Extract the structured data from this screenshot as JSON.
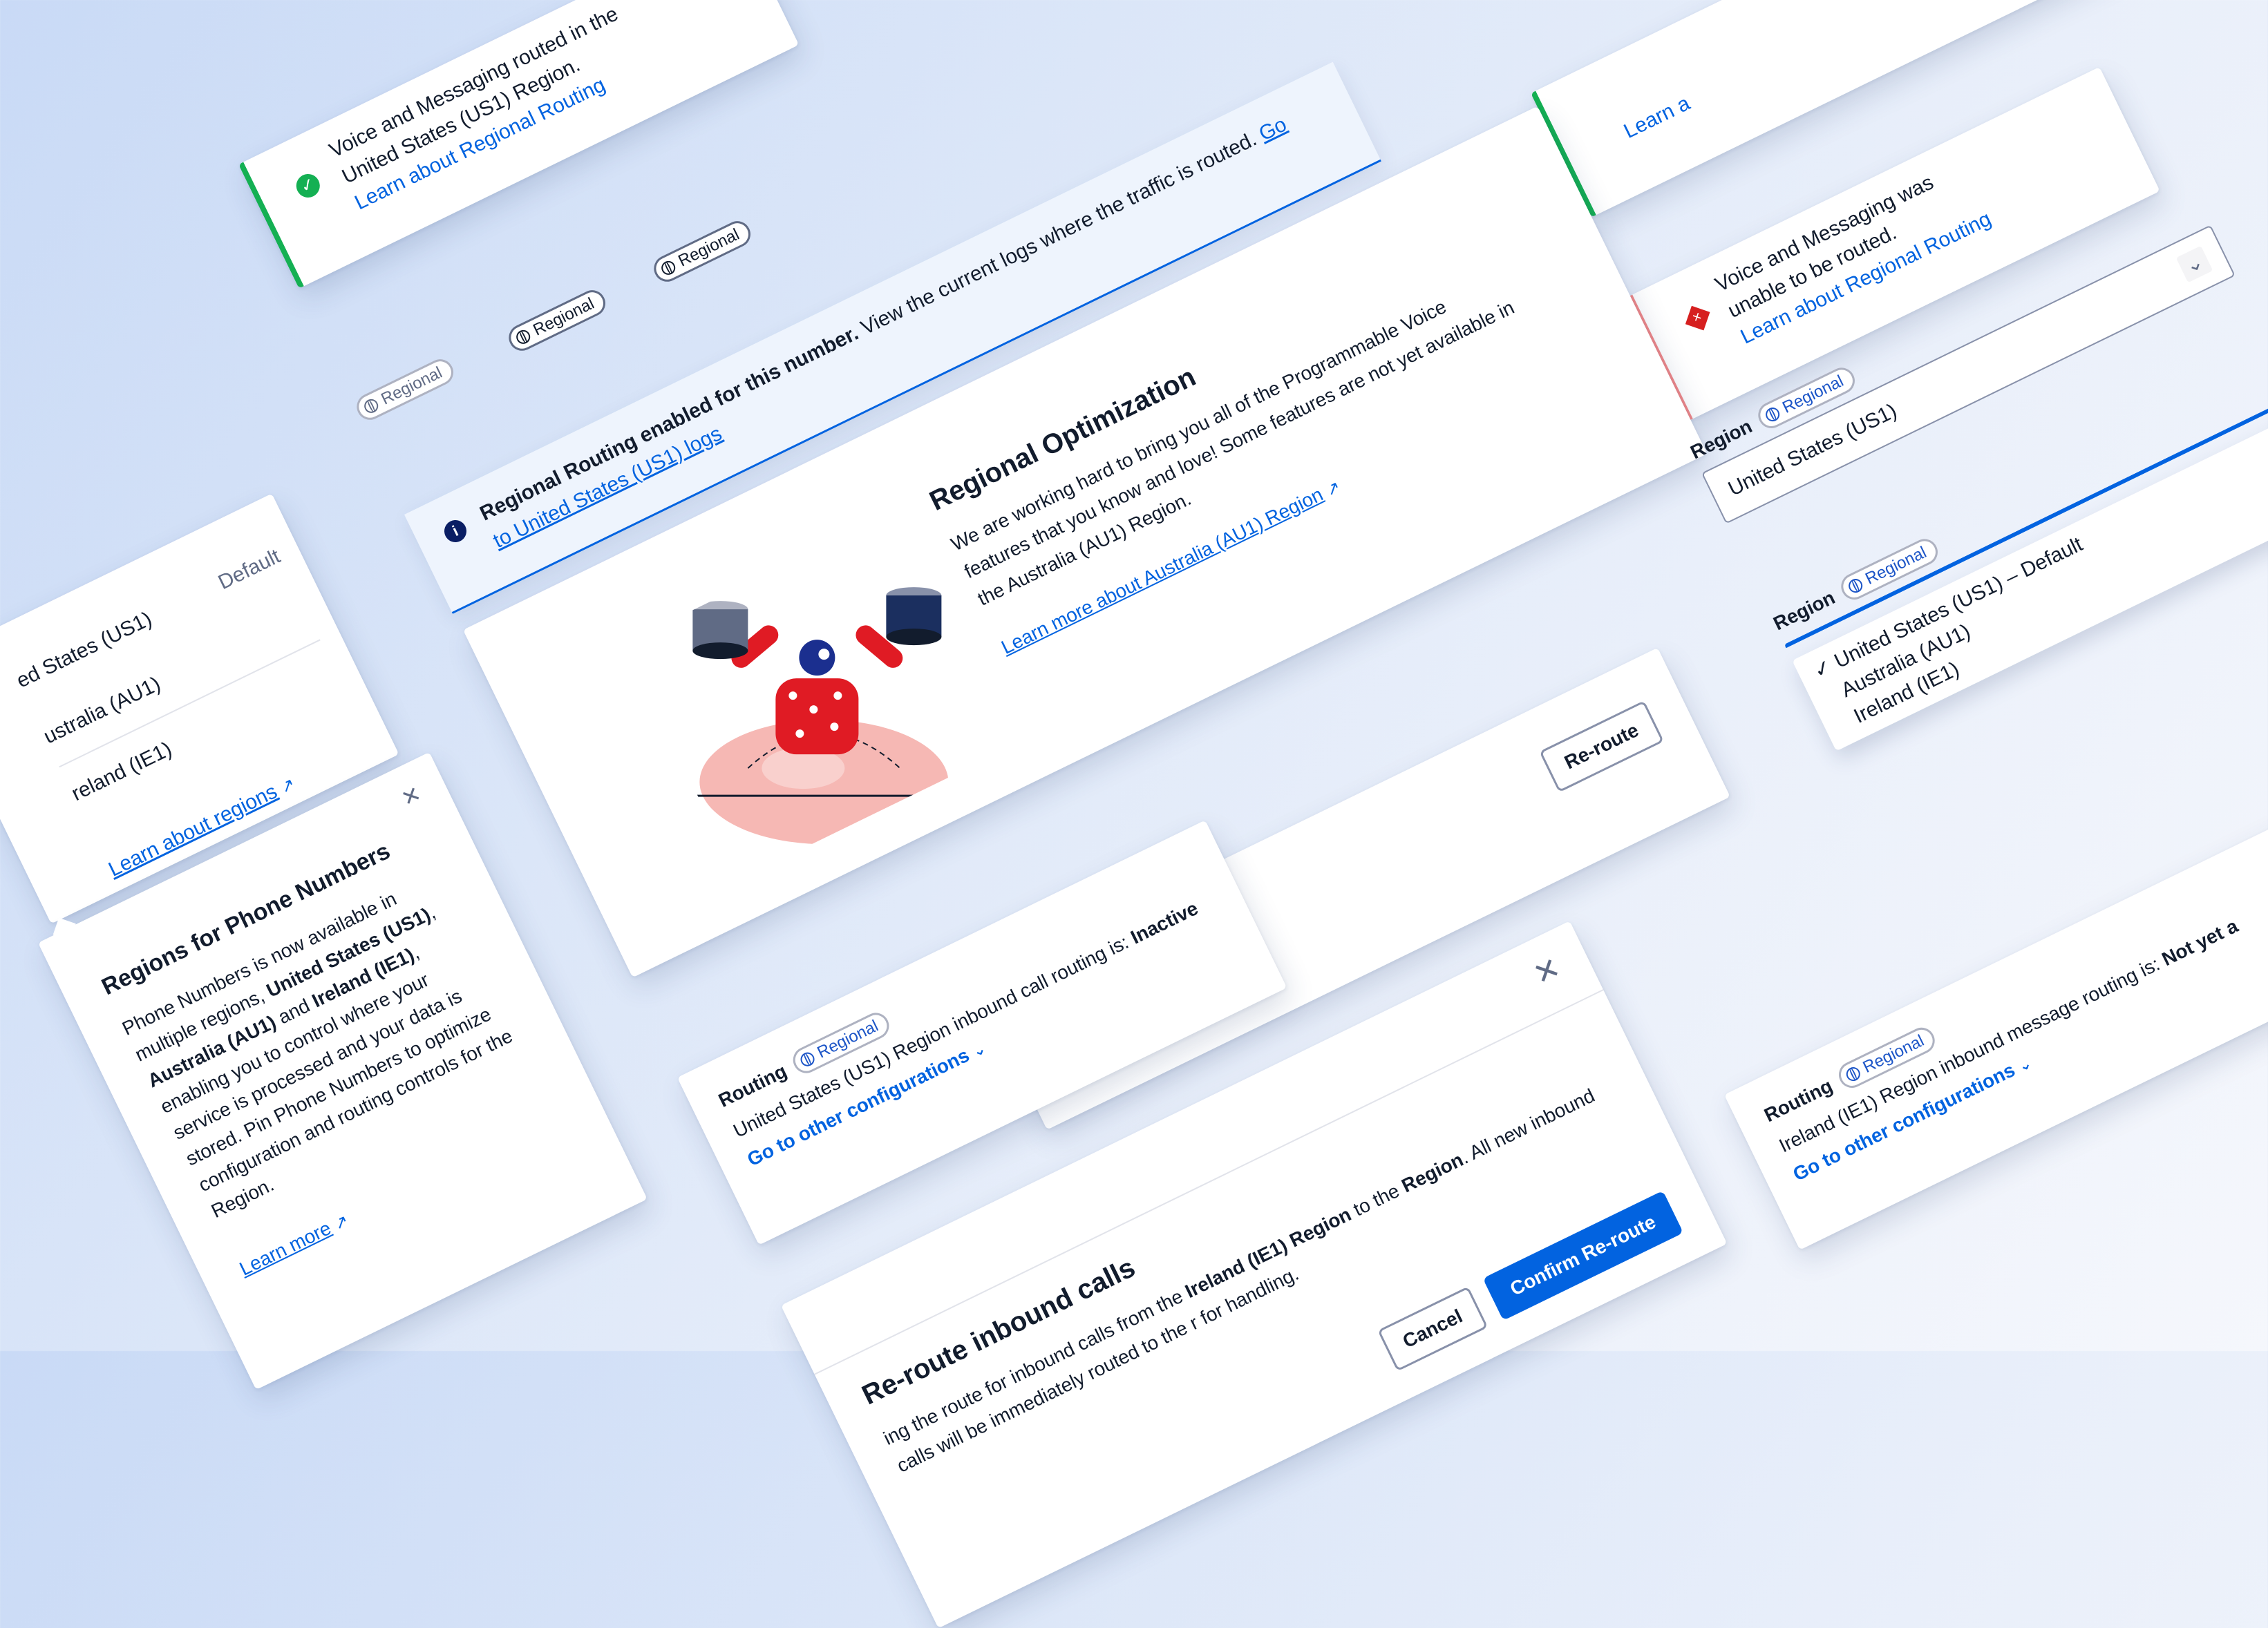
{
  "success_toast_left": {
    "message": "Voice and Messaging routed in the United States (US1) Region.",
    "link": "Learn about Regional Routing",
    "icon": "success-icon",
    "accent": "#14b053"
  },
  "success_toast_right": {
    "link": "Learn a",
    "accent": "#14b053"
  },
  "error_toast": {
    "message": "Voice and Messaging was unable to be routed.",
    "link": "Learn about Regional Routing",
    "icon": "error-icon",
    "accent": "#f58a8a"
  },
  "badges": {
    "label": "Regional",
    "icon": "globe-icon"
  },
  "info_banner": {
    "bold": "Regional Routing enabled for this number.",
    "text": " View the current logs where the traffic is routed.",
    "link": "Go to United States (US1) logs",
    "icon": "info-icon",
    "accent": "#0263e0"
  },
  "optimization_card": {
    "title": "Regional Optimization",
    "body": "We are working hard to bring you all of the Programmable Voice features that you know and love! Some features are not yet available in the Australia (AU1) Region.",
    "link": "Learn more about Australia (AU1) Region",
    "illustration": "astronaut-holding-databases-illustration"
  },
  "region_list_left": {
    "items": [
      {
        "label": "ed States (US1)",
        "tag": "Default"
      },
      {
        "label": "ustralia (AU1)",
        "tag": ""
      },
      {
        "label": "reland (IE1)",
        "tag": ""
      }
    ],
    "link": "Learn about regions"
  },
  "popover": {
    "title": "Regions for Phone Numbers",
    "body_parts": [
      "Phone Numbers is now available in multiple regions, ",
      "United States (US1)",
      ", ",
      "Australia (AU1)",
      " and ",
      "Ireland (IE1)",
      ", enabling you to control where your service is processed and your data is stored. Pin Phone Numbers to optimize configuration and routing controls for the Region."
    ],
    "link": "Learn more"
  },
  "reroute_card": {
    "button": "Re-route"
  },
  "routing_card_center": {
    "label": "Routing",
    "status_prefix": "United States (US1) Region inbound call routing is: ",
    "status_value": "Inactive",
    "link": "Go to other configurations"
  },
  "modal": {
    "title": "Re-route inbound calls",
    "body_a": "ing the route for inbound calls from the ",
    "body_b": "Ireland (IE1) Region",
    "body_c": " to the",
    "body_d": "Region",
    "body_e": ". All new inbound calls will be immediately routed to the",
    "body_f": "r for handling.",
    "cancel": "Cancel",
    "confirm": "Confirm Re-route"
  },
  "region_select_closed": {
    "label": "Region",
    "value": "United States (US1)"
  },
  "region_select_open": {
    "label": "Region",
    "options": [
      "United States (US1) – Default",
      "Australia (AU1)",
      "Ireland (IE1)"
    ],
    "selected_index": 0
  },
  "routing_card_right": {
    "label": "Routing",
    "status_prefix": "Ireland (IE1) Region inbound message routing is: ",
    "status_value": "Not yet a",
    "link": "Go to other configurations"
  }
}
